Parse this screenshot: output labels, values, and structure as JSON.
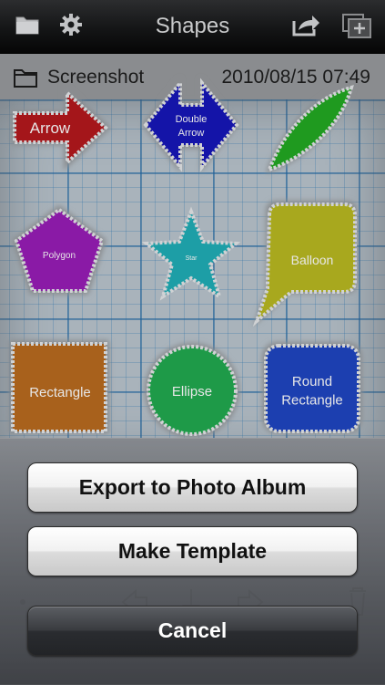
{
  "navbar": {
    "title": "Shapes",
    "left_icons": [
      "folder-icon",
      "gear-icon"
    ],
    "right_icons": [
      "share-icon",
      "add-page-icon"
    ]
  },
  "document": {
    "name": "Screenshot",
    "date": "2010/08/15 07:49"
  },
  "shapes": [
    {
      "label": "Arrow",
      "color": "#a4161a"
    },
    {
      "label": "Double Arrow",
      "color": "#1414a8"
    },
    {
      "label": "",
      "color": "#1f9a1f"
    },
    {
      "label": "Polygon",
      "color": "#8a1aa6"
    },
    {
      "label": "Star",
      "color": "#1d9ea6"
    },
    {
      "label": "Balloon",
      "color": "#a8a81e"
    },
    {
      "label": "Rectangle",
      "color": "#a8611c"
    },
    {
      "label": "Ellipse",
      "color": "#1e9a48"
    },
    {
      "label": "Round Rectangle",
      "color": "#1c3fb0"
    }
  ],
  "action_sheet": {
    "export_label": "Export to Photo Album",
    "template_label": "Make Template",
    "cancel_label": "Cancel"
  }
}
